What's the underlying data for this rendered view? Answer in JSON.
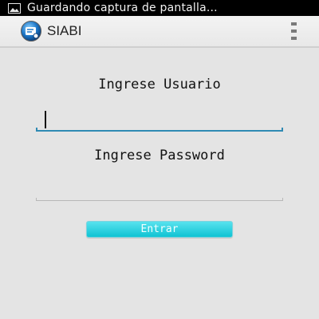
{
  "status_bar": {
    "notification_text": "Guardando captura de pantalla...",
    "notification_icon": "image-icon"
  },
  "action_bar": {
    "title": "SIABI",
    "app_icon": "siabi-logo-icon",
    "menu_icon": "overflow-menu-icon"
  },
  "form": {
    "user_label": "Ingrese Usuario",
    "user_value": "",
    "password_label": "Ingrese Password",
    "password_value": "",
    "submit_label": "Entrar"
  },
  "colors": {
    "background": "#e4e4e4",
    "status_bar": "#000000",
    "focus_underline": "#2f8ab3",
    "button": "#10c3d3"
  }
}
